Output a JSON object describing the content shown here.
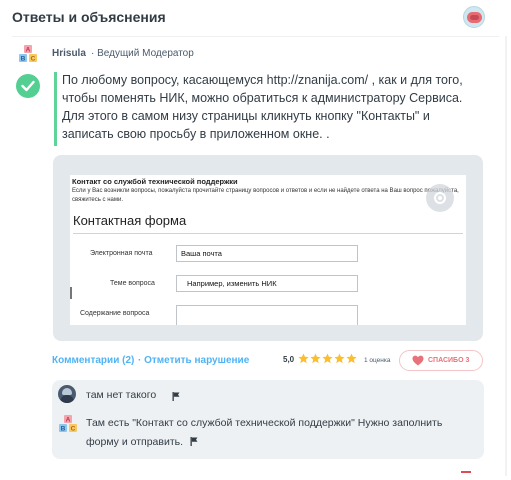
{
  "header": {
    "title": "Ответы и объяснения"
  },
  "author": {
    "name": "Hrisula",
    "rank": "· Ведущий Модератор"
  },
  "answer": {
    "paragraphs": [
      "По любому вопросу, касающемуся  http://znanija.com/  ,  как и для того, чтобы поменять НИК, можно обратиться к администратору Сервиса.",
      "Для этого в самом низу страницы кликнуть кнопку \"Контакты\" и записать свою просьбу в приложенном окне. ."
    ]
  },
  "attachment": {
    "title": "Контакт со службой технической поддержки",
    "description": "Если у Вас возникли вопросы, пожалуйста прочитайте страницу вопросов и ответов и если не найдете ответа на Ваш вопрос пожалуйста, свяжитесь с нами.",
    "form_title": "Контактная форма",
    "fields": [
      {
        "label": "Электронная почта",
        "value": "Ваша почта"
      },
      {
        "label": "Теме вопроса",
        "value": "Например, изменить НИК"
      },
      {
        "label": "Содержание вопроса",
        "value": ""
      }
    ]
  },
  "meta": {
    "comments_link": "Комментарии (2)",
    "report_link": "· Отметить нарушение",
    "rating": "5,0",
    "stars": 5,
    "rating_count": "1 оценка",
    "thanks": "СПАСИБО 3"
  },
  "comments": [
    {
      "text": "там нет такого"
    },
    {
      "text": "Там есть \"Контакт со службой технической поддержки\" Нужно заполнить форму и отправить."
    }
  ],
  "colors": {
    "accent_blue": "#4fb3f6",
    "check_green": "#53cf92",
    "star_gold": "#fbbe2e",
    "thanks_red": "#e8727a"
  }
}
